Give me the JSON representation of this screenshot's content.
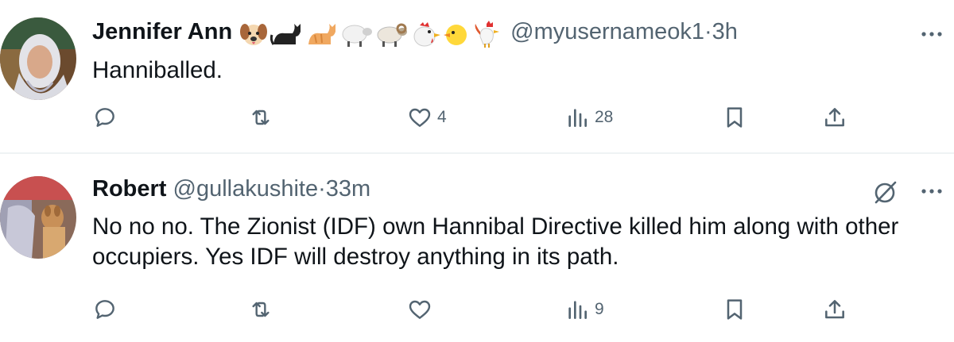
{
  "tweets": [
    {
      "name": "Jennifer Ann",
      "name_emojis": [
        "dog-face-emoji",
        "black-cat-emoji",
        "cat-emoji",
        "sheep-emoji",
        "ram-emoji",
        "chicken-emoji",
        "baby-chick-emoji",
        "rooster-emoji"
      ],
      "handle": "@myusernameok1",
      "separator": "·",
      "time": "3h",
      "text": "Hanniballed.",
      "counts": {
        "replies": "",
        "retweets": "",
        "likes": "4",
        "views": "28"
      }
    },
    {
      "name": "Robert",
      "handle": "@gullakushite",
      "separator": "·",
      "time": "33m",
      "text": "No no no. The Zionist (IDF) own Hannibal Directive killed him along with other occupiers. Yes IDF will destroy anything in its path.",
      "counts": {
        "replies": "",
        "retweets": "",
        "likes": "",
        "views": "9"
      }
    }
  ],
  "colors": {
    "text_primary": "#0f1419",
    "text_secondary": "#536471",
    "divider": "#eff3f4",
    "background": "#ffffff"
  }
}
